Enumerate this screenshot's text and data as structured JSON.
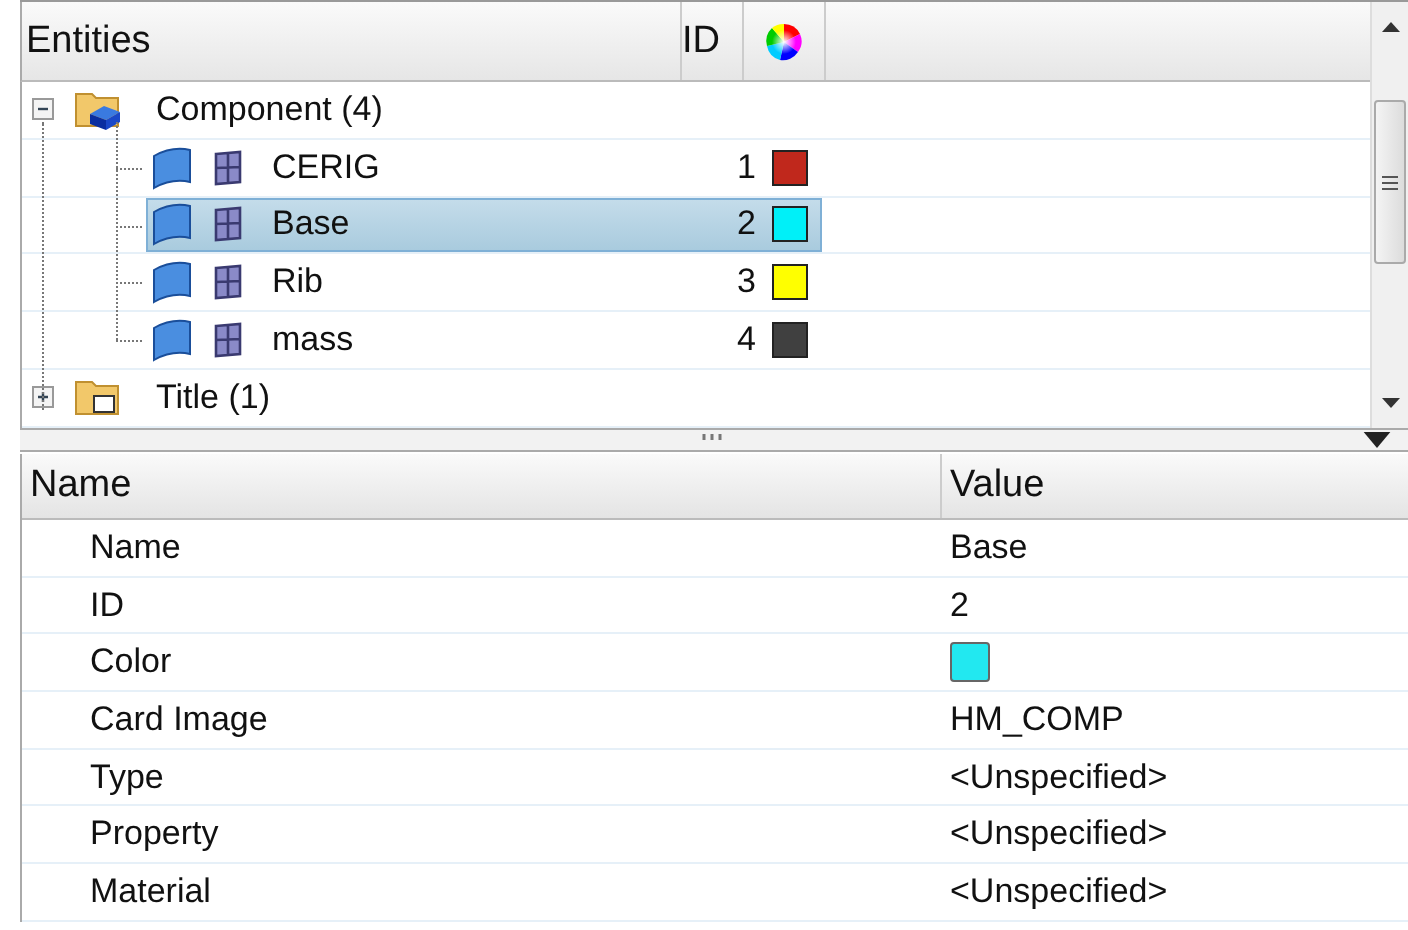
{
  "entities_panel": {
    "columns": [
      "Entities",
      "ID"
    ],
    "tree": [
      {
        "label": "Component (4)",
        "expanded": true,
        "children": [
          {
            "label": "CERIG",
            "id": "1",
            "color": "#c0281c",
            "selected": false
          },
          {
            "label": "Base",
            "id": "2",
            "color": "#00f0f8",
            "selected": true
          },
          {
            "label": "Rib",
            "id": "3",
            "color": "#ffff00",
            "selected": false
          },
          {
            "label": "mass",
            "id": "4",
            "color": "#404040",
            "selected": false
          }
        ]
      },
      {
        "label": "Title (1)",
        "expanded": false
      }
    ]
  },
  "properties_panel": {
    "columns": [
      "Name",
      "Value"
    ],
    "rows": [
      {
        "name": "Name",
        "kind": "text",
        "value": "Base"
      },
      {
        "name": "ID",
        "kind": "text",
        "value": "2"
      },
      {
        "name": "Color",
        "kind": "swatch",
        "color": "#22e8f0"
      },
      {
        "name": "Card Image",
        "kind": "text",
        "value": "HM_COMP"
      },
      {
        "name": "Type",
        "kind": "text",
        "value": "<Unspecified>"
      },
      {
        "name": "Property",
        "kind": "text",
        "value": "<Unspecified>"
      },
      {
        "name": "Material",
        "kind": "text",
        "value": "<Unspecified>"
      }
    ]
  }
}
